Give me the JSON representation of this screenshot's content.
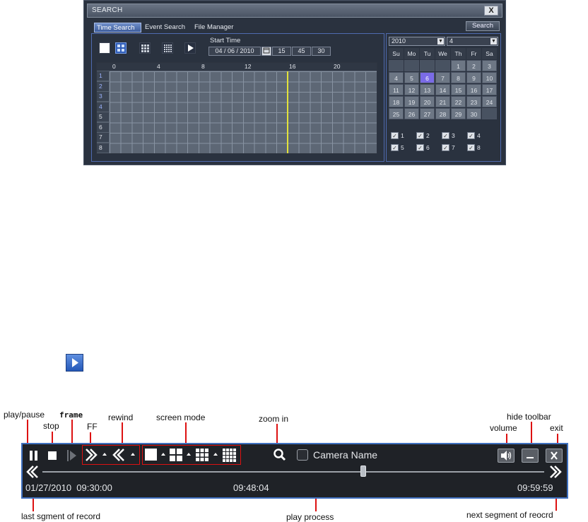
{
  "search_window": {
    "title": "SEARCH",
    "close": "X",
    "tabs": [
      "Time Search",
      "Event Search",
      "File Manager"
    ],
    "search_button": "Search",
    "start_time_label": "Start Time",
    "date": "04 / 06 / 2010",
    "time": [
      "15",
      "45",
      "30"
    ],
    "hours": [
      "0",
      "4",
      "8",
      "12",
      "16",
      "20"
    ],
    "channels": [
      "1",
      "2",
      "3",
      "4",
      "5",
      "6",
      "7",
      "8"
    ]
  },
  "calendar": {
    "year": "2010",
    "month": "4",
    "weekdays": [
      "Su",
      "Mo",
      "Tu",
      "We",
      "Th",
      "Fr",
      "Sa"
    ],
    "days": [
      "",
      "",
      "",
      "",
      "1",
      "2",
      "3",
      "4",
      "5",
      "6",
      "7",
      "8",
      "9",
      "10",
      "11",
      "12",
      "13",
      "14",
      "15",
      "16",
      "17",
      "18",
      "19",
      "20",
      "21",
      "22",
      "23",
      "24",
      "25",
      "26",
      "27",
      "28",
      "29",
      "30",
      ""
    ],
    "selected_day": "6",
    "cameras": [
      "1",
      "2",
      "3",
      "4",
      "5",
      "6",
      "7",
      "8"
    ]
  },
  "annotations": {
    "play_pause": "play/pause",
    "stop": "stop",
    "frame": "frame",
    "ff": "FF",
    "rewind": "rewind",
    "screen_mode": "screen mode",
    "zoom_in": "zoom in",
    "hide_toolbar": "hide toolbar",
    "volume": "volume",
    "exit": "exit",
    "last_segment": "last sgment of record",
    "play_process": "play process",
    "next_segment": "next segment of reocrd"
  },
  "toolbar": {
    "camera_name": "Camera Name",
    "start_time": "01/27/2010  09:30:00",
    "current_time": "09:48:04",
    "end_time": "09:59:59",
    "progress_fraction": 0.64
  }
}
